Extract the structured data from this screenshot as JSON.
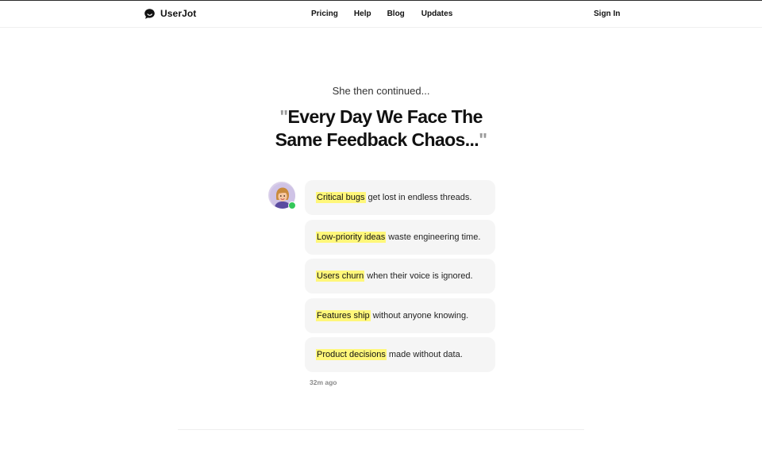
{
  "nav": {
    "brand": "UserJot",
    "brand_icon": "speech-bubble-icon",
    "links": [
      "Pricing",
      "Help",
      "Blog",
      "Updates"
    ],
    "signin": "Sign In"
  },
  "hero": {
    "lead": "She then continued...",
    "open_quote": "\"",
    "headline_line1": "Every Day We Face The",
    "headline_line2": "Same Feedback Chaos...",
    "close_quote": "\""
  },
  "avatar": {
    "icon": "user-avatar-icon",
    "status": "online",
    "status_color": "#34c759"
  },
  "messages": [
    {
      "highlight": "Critical bugs",
      "text": "get lost in endless threads."
    },
    {
      "highlight": "Low-priority ideas",
      "text": "waste engineering time."
    },
    {
      "highlight": "Users churn",
      "text": "when their voice is ignored."
    },
    {
      "highlight": "Features ship",
      "text": "without anyone knowing."
    },
    {
      "highlight": "Product decisions",
      "text": "made without data."
    }
  ],
  "timestamp": "32m ago",
  "colors": {
    "highlight": "#fff77a",
    "bubble_bg": "#f5f5f5",
    "text": "#111111"
  }
}
